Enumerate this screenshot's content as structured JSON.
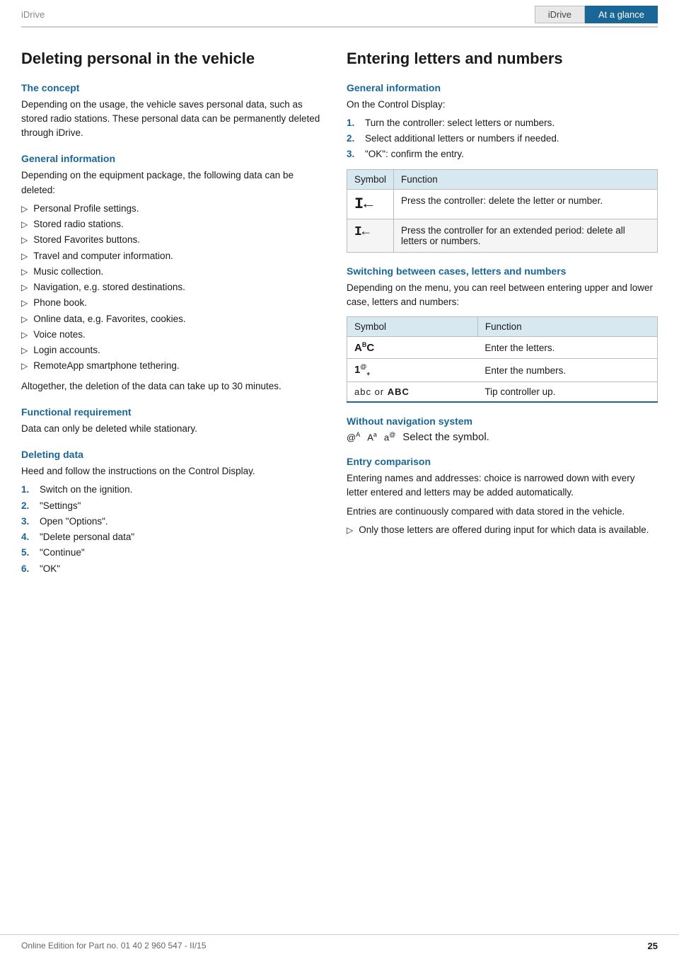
{
  "header": {
    "left_label": "iDrive",
    "tab1": "iDrive",
    "tab2": "At a glance"
  },
  "left": {
    "section_title": "Deleting personal in the vehicle",
    "concept_heading": "The concept",
    "concept_text": "Depending on the usage, the vehicle saves personal data, such as stored radio stations. These personal data can be permanently deleted through iDrive.",
    "general_info_heading": "General information",
    "general_info_text": "Depending on the equipment package, the following data can be deleted:",
    "bullet_items": [
      "Personal Profile settings.",
      "Stored radio stations.",
      "Stored Favorites buttons.",
      "Travel and computer information.",
      "Music collection.",
      "Navigation, e.g. stored destinations.",
      "Phone book.",
      "Online data, e.g. Favorites, cookies.",
      "Voice notes.",
      "Login accounts.",
      "RemoteApp smartphone tethering."
    ],
    "general_info_note": "Altogether, the deletion of the data can take up to 30 minutes.",
    "functional_req_heading": "Functional requirement",
    "functional_req_text": "Data can only be deleted while stationary.",
    "deleting_data_heading": "Deleting data",
    "deleting_data_text": "Heed and follow the instructions on the Control Display.",
    "steps": [
      {
        "num": "1.",
        "text": "Switch on the ignition."
      },
      {
        "num": "2.",
        "text": "\"Settings\""
      },
      {
        "num": "3.",
        "text": "Open \"Options\"."
      },
      {
        "num": "4.",
        "text": "\"Delete personal data\""
      },
      {
        "num": "5.",
        "text": "\"Continue\""
      },
      {
        "num": "6.",
        "text": "\"OK\""
      }
    ]
  },
  "right": {
    "section_title": "Entering letters and numbers",
    "general_info_heading": "General information",
    "general_info_text": "On the Control Display:",
    "steps": [
      {
        "num": "1.",
        "text": "Turn the controller: select letters or numbers."
      },
      {
        "num": "2.",
        "text": "Select additional letters or numbers if needed."
      },
      {
        "num": "3.",
        "text": "\"OK\": confirm the entry."
      }
    ],
    "table1": {
      "col1": "Symbol",
      "col2": "Function",
      "rows": [
        {
          "symbol": "I←",
          "function": "Press the controller: delete the letter or number."
        },
        {
          "symbol": "I←",
          "function": "Press the controller for an extended period: delete all letters or numbers."
        }
      ]
    },
    "switching_heading": "Switching between cases, letters and numbers",
    "switching_text": "Depending on the menu, you can reel between entering upper and lower case, letters and numbers:",
    "table2": {
      "col1": "Symbol",
      "col2": "Function",
      "rows": [
        {
          "symbol": "AᴬC",
          "function": "Enter the letters."
        },
        {
          "symbol": "1®+",
          "function": "Enter the numbers."
        },
        {
          "symbol": "abc or ABC",
          "function": "Tip controller up."
        }
      ]
    },
    "without_nav_heading": "Without navigation system",
    "without_nav_symbols": "æᴬ   Aᴬ   æᵐ",
    "without_nav_text": "Select the symbol.",
    "entry_comparison_heading": "Entry comparison",
    "entry_comparison_text1": "Entering names and addresses: choice is narrowed down with every letter entered and letters may be added automatically.",
    "entry_comparison_text2": "Entries are continuously compared with data stored in the vehicle.",
    "entry_bullet": "Only those letters are offered during input for which data is available."
  },
  "footer": {
    "left_text": "Online Edition for Part no. 01 40 2 960 547 - II/15",
    "right_text": "25"
  }
}
